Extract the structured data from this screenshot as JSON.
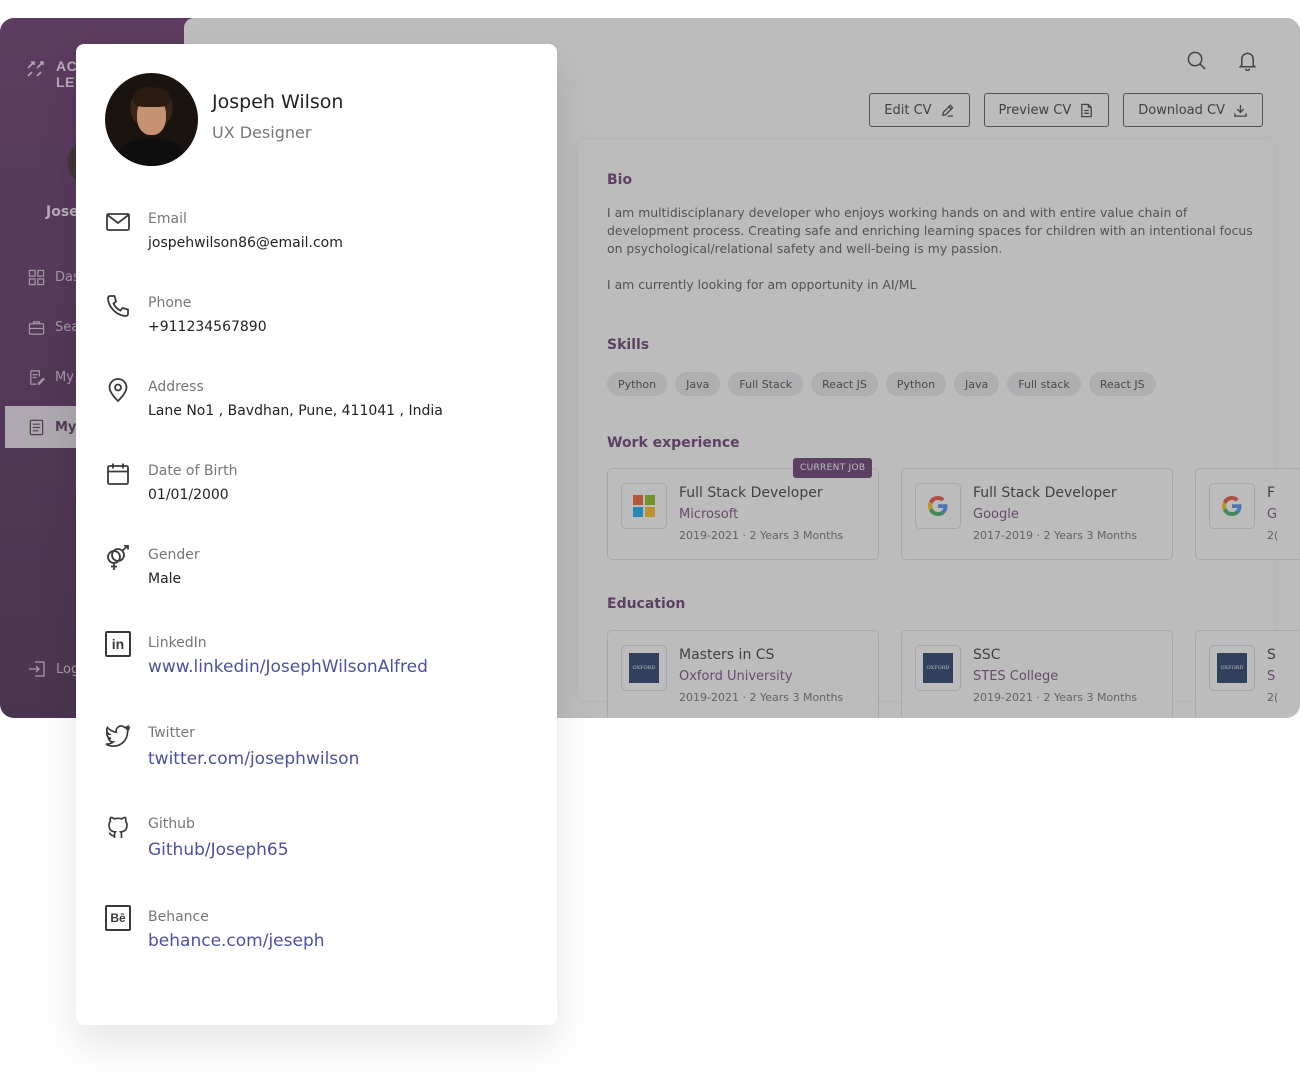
{
  "app": {
    "logo_text_line1": "AC",
    "logo_text_line2": "LE",
    "user_short": "Jose",
    "nav": [
      {
        "label": "Das",
        "icon": "dashboard-icon"
      },
      {
        "label": "Sea",
        "icon": "briefcase-icon"
      },
      {
        "label": "My",
        "icon": "edit-note-icon"
      },
      {
        "label": "My",
        "icon": "document-icon",
        "active": true
      }
    ],
    "logout_label": "Log",
    "actions": {
      "edit": "Edit CV",
      "preview": "Preview CV",
      "download": "Download CV"
    }
  },
  "cv": {
    "bio_title": "Bio",
    "bio_paragraph_1": "I am multidisciplanary developer who enjoys working hands on and with entire value chain of development process. Creating safe and enriching learning spaces for children with an intentional focus on psychological/relational safety and well-being is my passion.",
    "bio_paragraph_2": "I am currently looking for am opportunity in AI/ML",
    "skills_title": "Skills",
    "skills": [
      "Python",
      "Java",
      "Full Stack",
      "React JS",
      "Python",
      "Java",
      "Full stack",
      "React JS"
    ],
    "work_title": "Work experience",
    "current_badge": "CURRENT JOB",
    "work": [
      {
        "role": "Full Stack Developer",
        "company": "Microsoft",
        "period": "2019-2021 · 2 Years 3 Months",
        "logo": "microsoft-logo"
      },
      {
        "role": "Full Stack Developer",
        "company": "Google",
        "period": "2017-2019 · 2 Years 3 Months",
        "logo": "google-logo"
      },
      {
        "role": "F",
        "company": "G",
        "period": "2(",
        "logo": "google-logo"
      }
    ],
    "education_title": "Education",
    "education": [
      {
        "degree": "Masters in CS",
        "school": "Oxford University",
        "period": "2019-2021 · 2 Years 3 Months"
      },
      {
        "degree": "SSC",
        "school": "STES College",
        "period": "2019-2021 · 2 Years 3 Months"
      },
      {
        "degree": "S",
        "school": "S",
        "period": "2("
      }
    ],
    "oxford_text": "OXFORD"
  },
  "profile": {
    "name": "Jospeh Wilson",
    "role": "UX Designer",
    "fields": [
      {
        "label": "Email",
        "value": "jospehwilson86@email.com",
        "icon": "mail-icon"
      },
      {
        "label": "Phone",
        "value": "+911234567890",
        "icon": "phone-icon"
      },
      {
        "label": "Address",
        "value": "Lane No1 , Bavdhan, Pune, 411041 , India",
        "icon": "location-pin-icon"
      },
      {
        "label": "Date of Birth",
        "value": "01/01/2000",
        "icon": "calendar-icon"
      },
      {
        "label": "Gender",
        "value": "Male",
        "icon": "gender-icon"
      }
    ],
    "links": [
      {
        "label": "LinkedIn",
        "value": "www.linkedin/JosephWilsonAlfred",
        "icon": "linkedin-icon",
        "glyph": "in"
      },
      {
        "label": "Twitter",
        "value": "twitter.com/josephwilson",
        "icon": "twitter-icon"
      },
      {
        "label": "Github",
        "value": "Github/Joseph65",
        "icon": "github-icon"
      },
      {
        "label": "Behance",
        "value": "behance.com/jeseph",
        "icon": "behance-icon",
        "glyph": "Bē"
      }
    ]
  },
  "colors": {
    "accent": "#5c2a66",
    "link": "#4c50a3",
    "sidebar_top": "#5b2361",
    "sidebar_bottom": "#3c1845"
  }
}
